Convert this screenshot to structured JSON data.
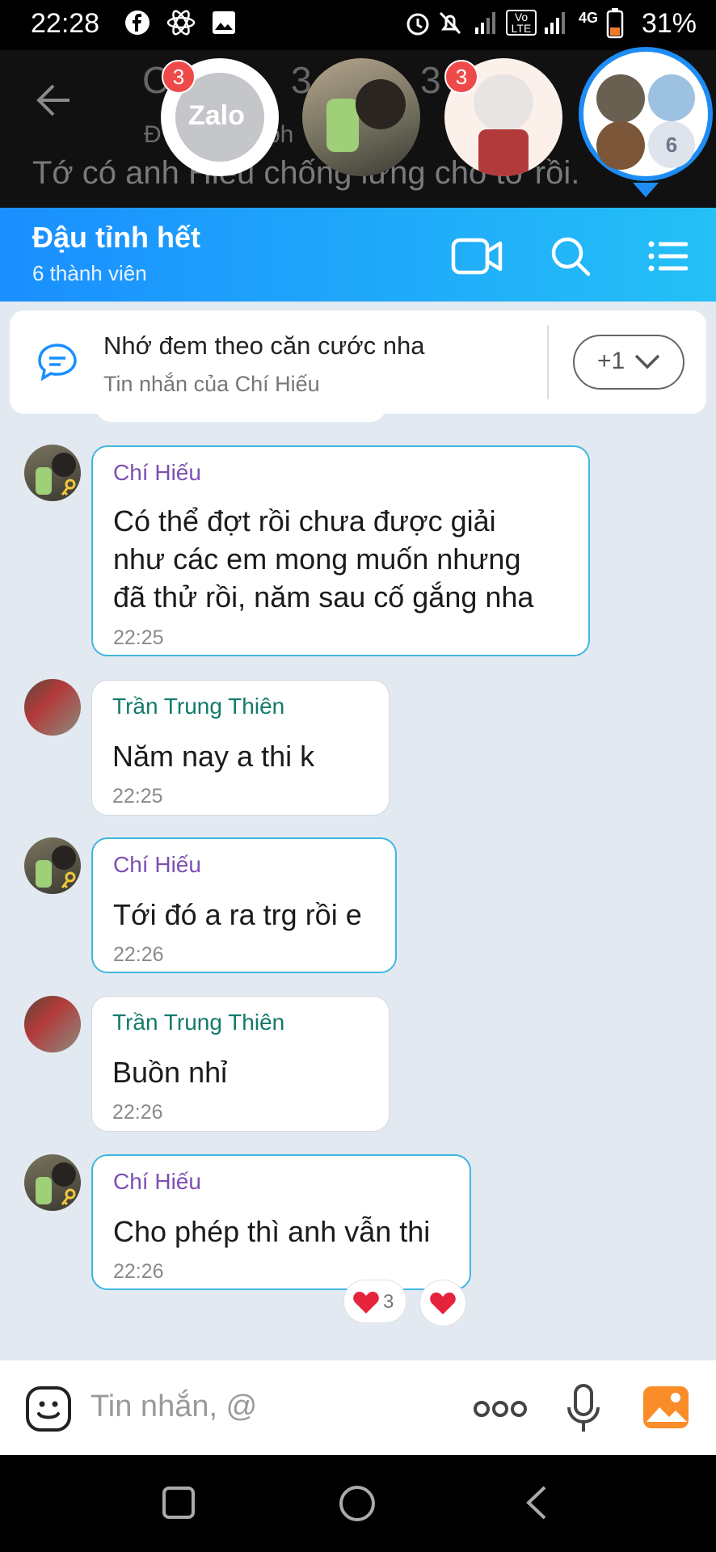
{
  "status_bar": {
    "time": "22:28",
    "battery": "31%",
    "net_label": "4G",
    "volte_label": "Vo LTE"
  },
  "background_header": {
    "title_fragment": "C",
    "title_fragment_2": "3",
    "title_fragment_3": "3",
    "subtitle_fragment": "Đ",
    "subtitle_fragment_2": "ph",
    "preview_text": "Tớ có anh Hiếu chống lưng cho tớ rồi."
  },
  "chat_heads": [
    {
      "name": "Zalo",
      "badge": "3"
    },
    {
      "name": "",
      "badge": ""
    },
    {
      "name": "",
      "badge": "3"
    },
    {
      "name": "",
      "group_count": "6"
    }
  ],
  "header": {
    "title": "Đậu tỉnh hết",
    "subtitle": "6 thành viên"
  },
  "pinned": {
    "text": "Nhớ đem theo căn cước nha",
    "source": "Tin nhắn của Chí Hiếu",
    "more_label": "+1"
  },
  "messages": [
    {
      "sender": "Chí Hiếu",
      "lines": [
        "Có thể đợt rồi chưa được giải",
        "như các em mong muốn nhưng",
        "đã thử rồi, năm sau cố gắng nha"
      ],
      "time": "22:25"
    },
    {
      "sender": "Trần Trung Thiên",
      "lines": [
        "Năm nay a thi k"
      ],
      "time": "22:25"
    },
    {
      "sender": "Chí Hiếu",
      "lines": [
        "Tới đó a ra trg rồi e"
      ],
      "time": "22:26"
    },
    {
      "sender": "Trần Trung Thiên",
      "lines": [
        "Buồn nhỉ"
      ],
      "time": "22:26"
    },
    {
      "sender": "Chí Hiếu",
      "lines": [
        "Cho phép thì anh vẫn thi"
      ],
      "time": "22:26"
    }
  ],
  "reactions": {
    "heart_count": "3"
  },
  "input": {
    "placeholder": "Tin nhắn, @"
  },
  "colors": {
    "header_start": "#1a8fff",
    "header_end": "#24c0f6",
    "chat_bg": "#e2e9f1",
    "own_border": "#3fb7df",
    "badge": "#ef4a4a"
  }
}
